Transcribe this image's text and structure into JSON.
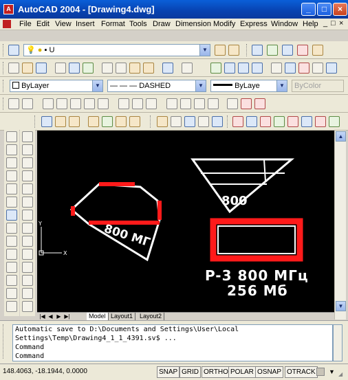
{
  "window": {
    "app_icon": "autocad-icon",
    "title": "AutoCAD 2004 - [Drawing4.dwg]",
    "controls": [
      "minimize",
      "maximize",
      "close"
    ]
  },
  "menu": {
    "items": [
      "File",
      "Edit",
      "View",
      "Insert",
      "Format",
      "Tools",
      "Draw",
      "Dimension",
      "Modify",
      "Express",
      "Window",
      "Help"
    ],
    "mdi_controls": [
      "_",
      "□",
      "×"
    ]
  },
  "layers": {
    "current": "U"
  },
  "properties": {
    "color": "ByLayer",
    "linetype": "DASHED",
    "lineweight": "ByLaye",
    "plotstyle": "ByColor"
  },
  "drawing": {
    "text_label_left": "800 МГ",
    "text_triangle": "800",
    "text_main_line1": "P-3 800 МГц",
    "text_main_line2": "256 Мб",
    "ucs_y": "Y",
    "ucs_x": "X",
    "colors": {
      "background": "#000000",
      "lines": "#ffffff",
      "highlight": "#ff1a1a"
    }
  },
  "tabs": [
    "Model",
    "Layout1",
    "Layout2"
  ],
  "command": {
    "lines": [
      "Automatic save to D:\\Documents and Settings\\User\\Local",
      "Settings\\Temp\\Drawing4_1_1_4391.sv$ ...",
      "Command",
      "Command"
    ]
  },
  "status": {
    "coords": "148.4063, -18.1944, 0.0000",
    "toggles": [
      "SNAP",
      "GRID",
      "ORTHO",
      "POLAR",
      "OSNAP",
      "OTRACK"
    ]
  }
}
